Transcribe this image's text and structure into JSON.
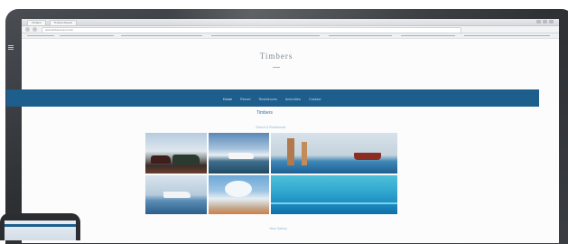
{
  "browser": {
    "tabs": [
      "Timbers",
      "Timbers Resort"
    ],
    "url": "www.timbersresort.com"
  },
  "site": {
    "logo_text": "Timbers",
    "nav": [
      "Home",
      "Resort",
      "Residences",
      "Amenities",
      "Contact"
    ],
    "section_title": "Timbers",
    "section_subtitle": "Resort & Residences",
    "caption": "View Gallery"
  },
  "colors": {
    "navbar": "#1d5e8d",
    "accent_text": "#2f6fa2",
    "bezel": "#2d2f33"
  }
}
